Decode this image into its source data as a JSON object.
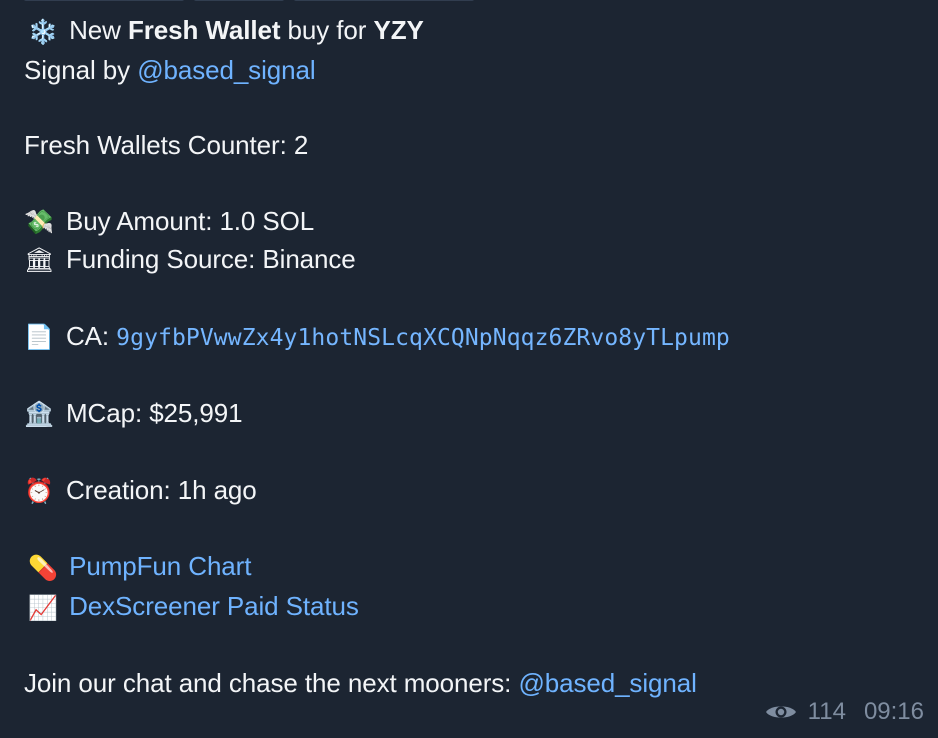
{
  "message": {
    "title_prefix": "New ",
    "title_bold": "Fresh Wallet",
    "title_mid": " buy for ",
    "title_token": "YZY",
    "signal_by_label": "Signal by ",
    "signal_by_handle": "@based_signal",
    "counter": "Fresh Wallets Counter: 2",
    "buy_amount": "Buy Amount: 1.0 SOL",
    "funding_source": "Funding Source: Binance",
    "ca_label": "CA: ",
    "ca_value": "9gyfbPVwwZx4y1hotNSLcqXCQNpNqqz6ZRvo8yTLpump",
    "mcap": "MCap: $25,991",
    "creation": "Creation: 1h ago",
    "pumpfun_link": "PumpFun Chart",
    "dexscreener_link": "DexScreener Paid Status",
    "join_text": "Join our chat and chase the next mooners: ",
    "join_handle": "@based_signal"
  },
  "icons": {
    "snowflake": "❄️",
    "money_wings": "💸",
    "bank_building": "🏛",
    "document": "📄",
    "bank": "🏦",
    "alarm_clock": "⏰",
    "pill": "💊",
    "chart_up": "📈"
  },
  "footer": {
    "views": "114",
    "time": "09:16"
  },
  "colors": {
    "background": "#1c2532",
    "text": "#f3f5f7",
    "link": "#6fb3ff",
    "meta": "#7f8da0"
  }
}
